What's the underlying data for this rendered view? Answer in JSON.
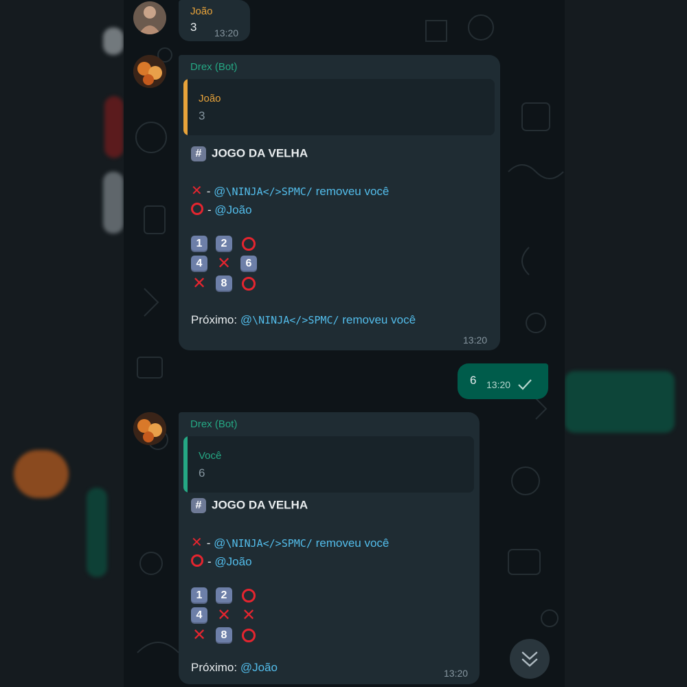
{
  "colors": {
    "chat_bg": "#0e1418",
    "incoming_bubble": "#1f2c33",
    "outgoing_bubble": "#005c4b",
    "joao_name": "#e8a33a",
    "bot_name": "#25a884",
    "link": "#53bdeb",
    "red_mark": "#e5252f"
  },
  "msg1": {
    "sender": "João",
    "text": "3",
    "time": "13:20",
    "avatar_icon": "user-avatar-icon"
  },
  "msg2": {
    "sender": "Drex (Bot)",
    "avatar_icon": "bot-avatar-icon",
    "quote": {
      "name": "João",
      "text": "3"
    },
    "title": "JOGO DA VELHA",
    "hash_symbol": "#",
    "player_x": {
      "dash": "-",
      "mention": "@",
      "name": "\\NINJA</>SPMC/",
      "suffix": "removeu você"
    },
    "player_o": {
      "dash": "-",
      "mention": "@João"
    },
    "board": [
      [
        "1",
        "2",
        "O"
      ],
      [
        "4",
        "X",
        "6"
      ],
      [
        "X",
        "8",
        "O"
      ]
    ],
    "next_label": "Próximo:",
    "next_mention": "@",
    "next_name": "\\NINJA</>SPMC/",
    "next_suffix": "removeu você",
    "time": "13:20"
  },
  "msg3": {
    "text": "6",
    "time": "13:20",
    "status_icon": "check-icon"
  },
  "msg4": {
    "sender": "Drex (Bot)",
    "avatar_icon": "bot-avatar-icon",
    "quote": {
      "name": "Você",
      "text": "6"
    },
    "title": "JOGO DA VELHA",
    "hash_symbol": "#",
    "player_x": {
      "dash": "-",
      "mention": "@",
      "name": "\\NINJA</>SPMC/",
      "suffix": "removeu você"
    },
    "player_o": {
      "dash": "-",
      "mention": "@João"
    },
    "board": [
      [
        "1",
        "2",
        "O"
      ],
      [
        "4",
        "X",
        "X"
      ],
      [
        "X",
        "8",
        "O"
      ]
    ],
    "next_label": "Próximo:",
    "next_mention": "@João",
    "time": "13:20"
  },
  "scroll_button": {
    "icon": "double-chevron-down-icon"
  }
}
